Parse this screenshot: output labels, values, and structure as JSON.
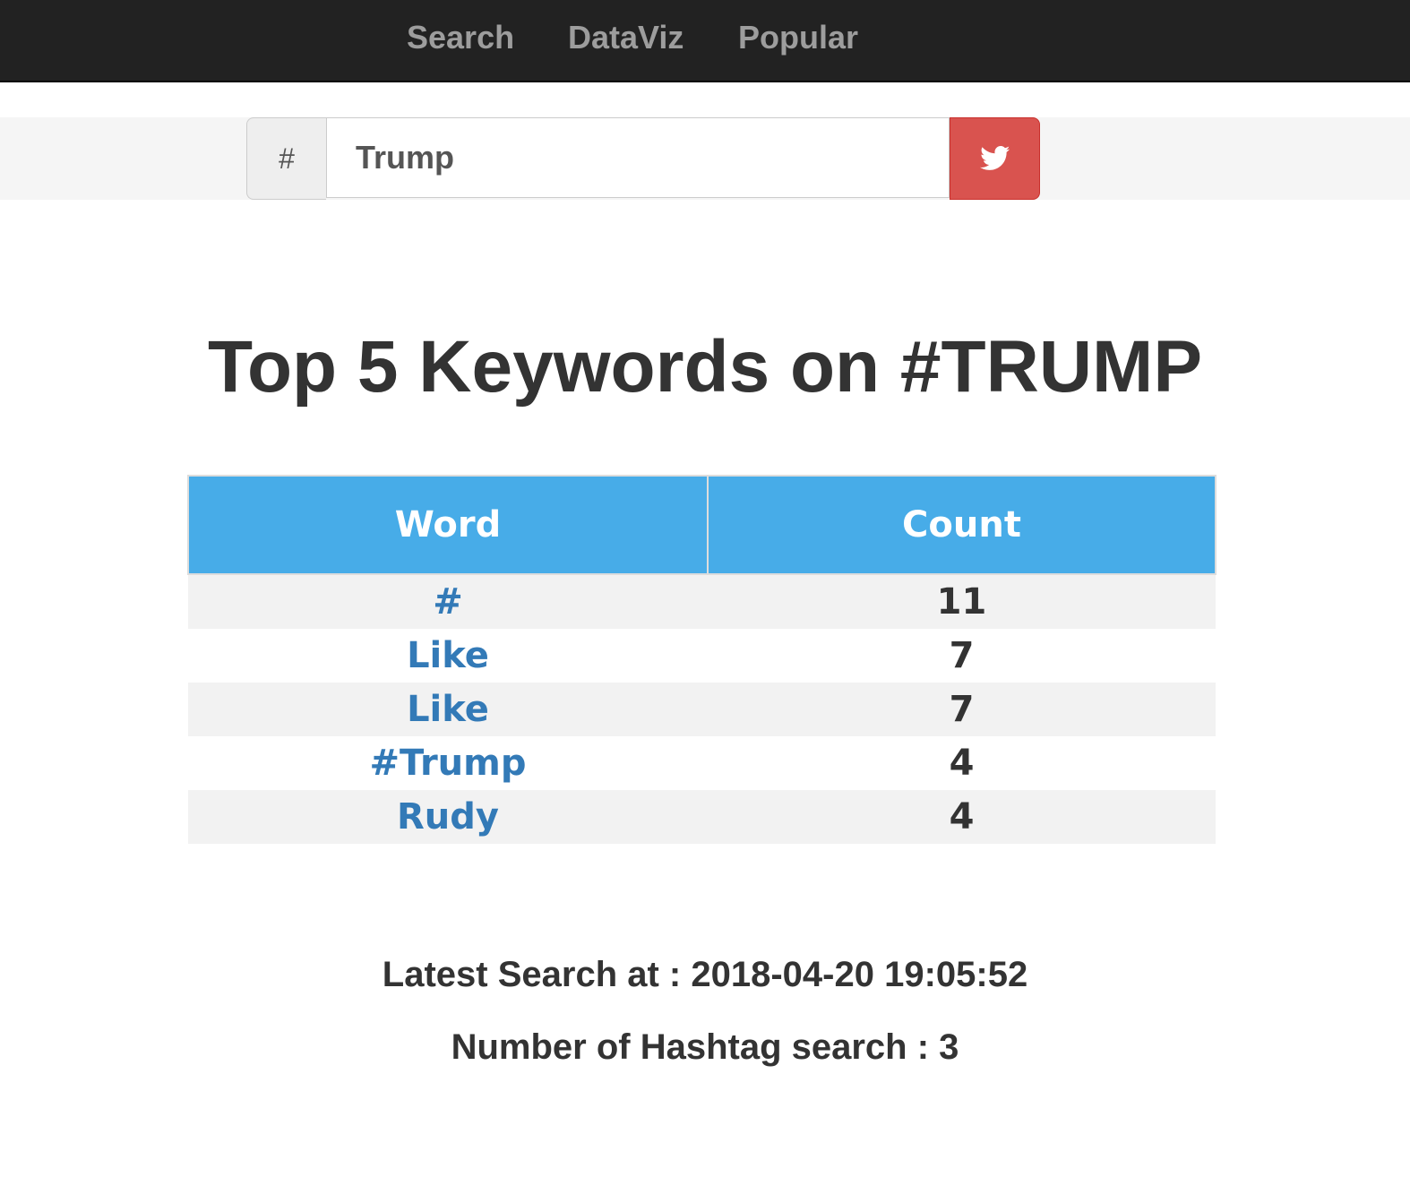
{
  "nav": {
    "items": [
      {
        "label": "Search"
      },
      {
        "label": "DataViz"
      },
      {
        "label": "Popular"
      }
    ]
  },
  "search": {
    "prefix": "#",
    "value": "Trump",
    "button_icon": "twitter-bird-icon"
  },
  "main": {
    "title": "Top 5 Keywords on #TRUMP",
    "table": {
      "columns": [
        "Word",
        "Count"
      ],
      "rows": [
        {
          "word": "#",
          "count": "11"
        },
        {
          "word": "Like",
          "count": "7"
        },
        {
          "word": "Like",
          "count": "7"
        },
        {
          "word": "#Trump",
          "count": "4"
        },
        {
          "word": "Rudy",
          "count": "4"
        }
      ]
    },
    "latest_search": "Latest Search at : 2018-04-20 19:05:52",
    "hashtag_count": "Number of Hashtag search : 3"
  },
  "colors": {
    "navbar": "#222222",
    "nav_link": "#9d9d9d",
    "header": "#47ace8",
    "button": "#d9534f",
    "link": "#337ab7"
  }
}
